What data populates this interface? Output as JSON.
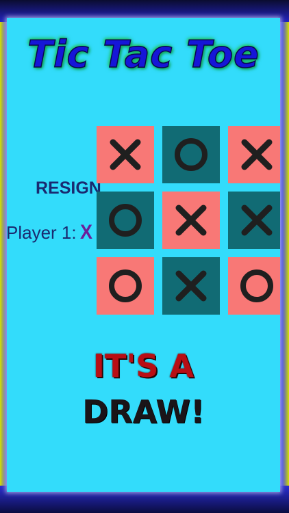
{
  "title": "Tic Tac Toe",
  "sidebar": {
    "resign_label": "RESIGN",
    "player_label": "Player 1:",
    "player_mark": "X"
  },
  "board": {
    "cells": [
      {
        "color": "pink",
        "mark": "X"
      },
      {
        "color": "teal",
        "mark": "O"
      },
      {
        "color": "pink",
        "mark": "X"
      },
      {
        "color": "teal",
        "mark": "O"
      },
      {
        "color": "pink",
        "mark": "X"
      },
      {
        "color": "teal",
        "mark": "X"
      },
      {
        "color": "pink",
        "mark": "O"
      },
      {
        "color": "teal",
        "mark": "X"
      },
      {
        "color": "pink",
        "mark": "O"
      }
    ]
  },
  "result": {
    "line1": "IT'S A",
    "line2": "DRAW!"
  },
  "colors": {
    "background": "#33dcfb",
    "cell_pink": "#f87876",
    "cell_teal": "#116b74",
    "mark": "#1f1f1f",
    "title": "#1616d8",
    "result_red": "#b80e14"
  }
}
